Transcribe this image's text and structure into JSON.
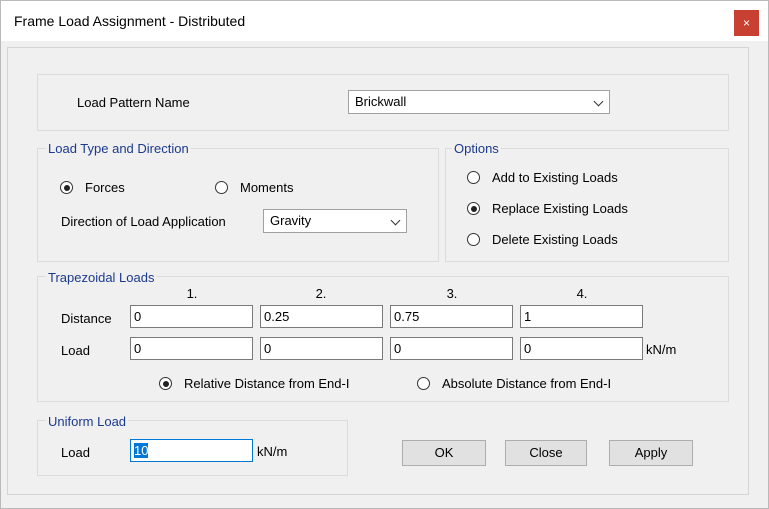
{
  "window": {
    "title": "Frame Load Assignment - Distributed",
    "close_glyph": "×"
  },
  "load_pattern": {
    "label": "Load Pattern Name",
    "value": "Brickwall"
  },
  "load_type": {
    "legend": "Load Type and Direction",
    "forces_label": "Forces",
    "moments_label": "Moments",
    "forces_selected": true,
    "direction_label": "Direction of Load Application",
    "direction_value": "Gravity"
  },
  "options": {
    "legend": "Options",
    "items": [
      {
        "label": "Add to Existing Loads",
        "selected": false
      },
      {
        "label": "Replace Existing Loads",
        "selected": true
      },
      {
        "label": "Delete Existing Loads",
        "selected": false
      }
    ]
  },
  "trapezoidal": {
    "legend": "Trapezoidal Loads",
    "columns": [
      "1.",
      "2.",
      "3.",
      "4."
    ],
    "distance_label": "Distance",
    "load_label": "Load",
    "distances": [
      "0",
      "0.25",
      "0.75",
      "1"
    ],
    "loads": [
      "0",
      "0",
      "0",
      "0"
    ],
    "unit": "kN/m",
    "relative_label": "Relative Distance from End-I",
    "absolute_label": "Absolute Distance from End-I",
    "relative_selected": true
  },
  "uniform": {
    "legend": "Uniform Load",
    "load_label": "Load",
    "value": "10",
    "unit": "kN/m"
  },
  "buttons": {
    "ok": "OK",
    "close": "Close",
    "apply": "Apply"
  }
}
